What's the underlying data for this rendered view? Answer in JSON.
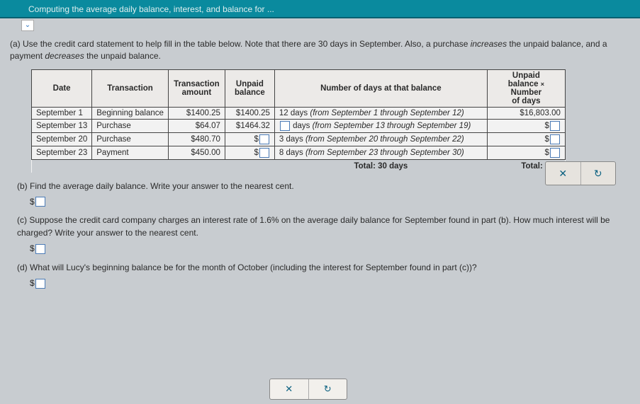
{
  "topbar": {
    "title": "Computing the average daily balance, interest, and balance for ..."
  },
  "partA": {
    "label": "(a)",
    "text_before": "Use the credit card statement to help fill in the table below. Note that there are 30 days in September. Also, a purchase ",
    "em1": "increases",
    "text_mid": " the unpaid balance, and a payment ",
    "em2": "decreases",
    "text_after": " the unpaid balance."
  },
  "headers": {
    "date": "Date",
    "trans": "Transaction",
    "amount": "Transaction amount",
    "unpaid": "Unpaid balance",
    "ndays": "Number of days at that balance",
    "prod": "Unpaid balance × Number of days"
  },
  "rows": [
    {
      "date": "September 1",
      "trans": "Beginning balance",
      "amount": "$1400.25",
      "unpaid": "$1400.25",
      "days_pre": "12 days ",
      "days_em": "(from September 1 through September 12)",
      "prod": "$16,803.00",
      "unpaid_input": false,
      "days_input": false,
      "prod_input": false
    },
    {
      "date": "September 13",
      "trans": "Purchase",
      "amount": "$64.07",
      "unpaid": "$1464.32",
      "days_pre": " days ",
      "days_em": "(from September 13 through September 19)",
      "prod": "$",
      "unpaid_input": false,
      "days_input": true,
      "prod_input": true
    },
    {
      "date": "September 20",
      "trans": "Purchase",
      "amount": "$480.70",
      "unpaid": "$",
      "days_pre": "3 days ",
      "days_em": "(from September 20 through September 22)",
      "prod": "$",
      "unpaid_input": true,
      "days_input": false,
      "prod_input": true
    },
    {
      "date": "September 23",
      "trans": "Payment",
      "amount": "$450.00",
      "unpaid": "$",
      "days_pre": "8 days ",
      "days_em": "(from September 23 through September 30)",
      "prod": "$",
      "unpaid_input": true,
      "days_input": false,
      "prod_input": true
    }
  ],
  "totals": {
    "days_label": "Total:",
    "days_val": "30 days",
    "prod_label": "Total:",
    "prod_val": "$"
  },
  "partB": {
    "label": "(b)",
    "text": "Find the average daily balance. Write your answer to the nearest cent."
  },
  "partC": {
    "label": "(c)",
    "text": "Suppose the credit card company charges an interest rate of 1.6% on the average daily balance for September found in part (b). How much interest will be charged? Write your answer to the nearest cent."
  },
  "partD": {
    "label": "(d)",
    "text": "What will Lucy's beginning balance be for the month of October (including the interest for September found in part (c))?"
  },
  "controls": {
    "close": "✕",
    "reset": "↻"
  }
}
